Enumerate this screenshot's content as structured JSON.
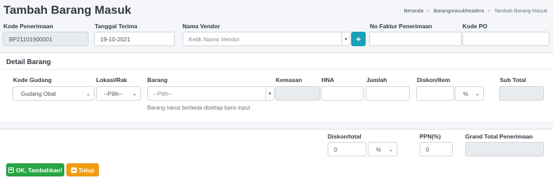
{
  "header": {
    "title": "Tambah Barang Masuk",
    "breadcrumb": [
      "Beranda",
      "Barangmasukheaders",
      "Tambah Barang Masuk"
    ]
  },
  "form_top": {
    "kode_penerimaan_label": "Kode Penerimaan",
    "kode_penerimaan_value": "BP21101900001",
    "tanggal_label": "Tanggal Terima",
    "tanggal_value": "19-10-2021",
    "vendor_label": "Nama Vendor",
    "vendor_placeholder": "Ketik Nama Vendor",
    "add_vendor_icon": "+",
    "faktur_label": "No Faktur Penerimaan",
    "faktur_value": "",
    "kode_po_label": "Kode PO",
    "kode_po_value": ""
  },
  "detail": {
    "title": "Detail Barang",
    "columns": {
      "kode_gudang": "Kode Gudang",
      "lokasi": "Lokasi/Rak",
      "barang": "Barang",
      "kemasan": "Kemasan",
      "hna": "HNA",
      "jumlah": "Jumlah",
      "diskon_item": "Diskon/Item",
      "sub_total": "Sub Total"
    },
    "row": {
      "kode_gudang": "Gudang Obat",
      "lokasi": "--Pilih--",
      "barang_placeholder": "--Pilih--",
      "kemasan": "",
      "hna": "",
      "jumlah": "",
      "diskon_item": "",
      "diskon_unit": "%",
      "sub_total": ""
    },
    "help_text": "Barang harus berbeda disetiap baris input"
  },
  "totals": {
    "diskon_total_label": "Diskon/total",
    "diskon_total_value": "0",
    "diskon_total_unit": "%",
    "ppn_label": "PPN(%)",
    "ppn_value": "0",
    "grand_total_label": "Grand Total Penerimaan",
    "grand_total_value": ""
  },
  "actions": {
    "ok_label": "OK, Tambahkan!",
    "close_label": "Tutup"
  },
  "icons": {
    "ok": "floppy-disk-icon",
    "close": "minus-square-icon",
    "select": "chevron-down-icon"
  },
  "colors": {
    "primary": "#17a2b8",
    "success": "#28a745",
    "warning": "#f39c12",
    "background": "#f4f6f9"
  }
}
